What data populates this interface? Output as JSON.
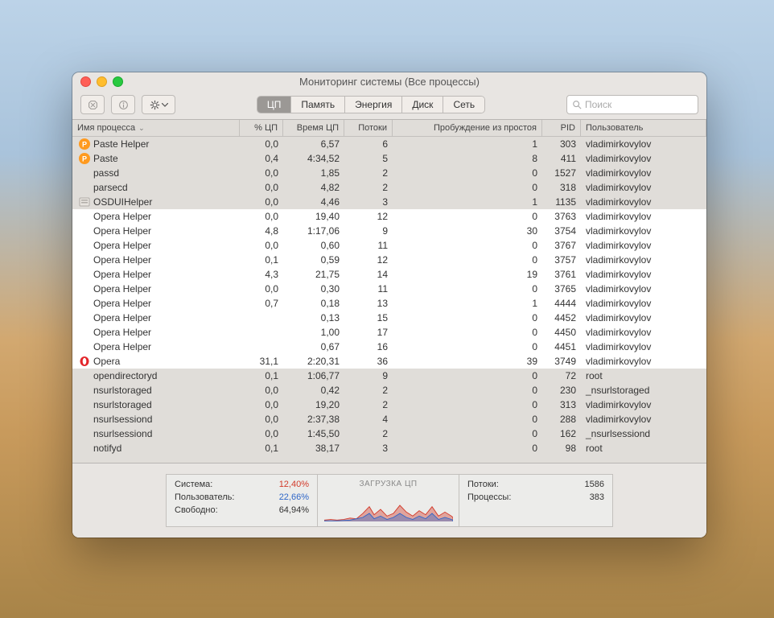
{
  "window": {
    "title": "Мониторинг системы (Все процессы)"
  },
  "toolbar": {
    "tabs": [
      "ЦП",
      "Память",
      "Энергия",
      "Диск",
      "Сеть"
    ],
    "active_tab": 0,
    "search_placeholder": "Поиск"
  },
  "columns": {
    "name": "Имя процесса",
    "cpu": "% ЦП",
    "time": "Время ЦП",
    "threads": "Потоки",
    "wake": "Пробуждение из простоя",
    "pid": "PID",
    "user": "Пользователь"
  },
  "rows": [
    {
      "icon": "paste",
      "indent": 1,
      "name": "Paste Helper",
      "cpu": "0,0",
      "time": "6,57",
      "threads": "6",
      "wake": "1",
      "pid": "303",
      "user": "vladimirkovylov",
      "sel": false
    },
    {
      "icon": "paste",
      "indent": 1,
      "name": "Paste",
      "cpu": "0,4",
      "time": "4:34,52",
      "threads": "5",
      "wake": "8",
      "pid": "411",
      "user": "vladimirkovylov",
      "sel": false
    },
    {
      "icon": "none",
      "indent": 2,
      "name": "passd",
      "cpu": "0,0",
      "time": "1,85",
      "threads": "2",
      "wake": "0",
      "pid": "1527",
      "user": "vladimirkovylov",
      "sel": false
    },
    {
      "icon": "none",
      "indent": 2,
      "name": "parsecd",
      "cpu": "0,0",
      "time": "4,82",
      "threads": "2",
      "wake": "0",
      "pid": "318",
      "user": "vladimirkovylov",
      "sel": false
    },
    {
      "icon": "generic",
      "indent": 1,
      "name": "OSDUIHelper",
      "cpu": "0,0",
      "time": "4,46",
      "threads": "3",
      "wake": "1",
      "pid": "1135",
      "user": "vladimirkovylov",
      "sel": false
    },
    {
      "icon": "none",
      "indent": 2,
      "name": "Opera Helper",
      "cpu": "0,0",
      "time": "19,40",
      "threads": "12",
      "wake": "0",
      "pid": "3763",
      "user": "vladimirkovylov",
      "sel": true
    },
    {
      "icon": "none",
      "indent": 2,
      "name": "Opera Helper",
      "cpu": "4,8",
      "time": "1:17,06",
      "threads": "9",
      "wake": "30",
      "pid": "3754",
      "user": "vladimirkovylov",
      "sel": true
    },
    {
      "icon": "none",
      "indent": 2,
      "name": "Opera Helper",
      "cpu": "0,0",
      "time": "0,60",
      "threads": "11",
      "wake": "0",
      "pid": "3767",
      "user": "vladimirkovylov",
      "sel": true
    },
    {
      "icon": "none",
      "indent": 2,
      "name": "Opera Helper",
      "cpu": "0,1",
      "time": "0,59",
      "threads": "12",
      "wake": "0",
      "pid": "3757",
      "user": "vladimirkovylov",
      "sel": true
    },
    {
      "icon": "none",
      "indent": 2,
      "name": "Opera Helper",
      "cpu": "4,3",
      "time": "21,75",
      "threads": "14",
      "wake": "19",
      "pid": "3761",
      "user": "vladimirkovylov",
      "sel": true
    },
    {
      "icon": "none",
      "indent": 2,
      "name": "Opera Helper",
      "cpu": "0,0",
      "time": "0,30",
      "threads": "11",
      "wake": "0",
      "pid": "3765",
      "user": "vladimirkovylov",
      "sel": true
    },
    {
      "icon": "none",
      "indent": 2,
      "name": "Opera Helper",
      "cpu": "0,7",
      "time": "0,18",
      "threads": "13",
      "wake": "1",
      "pid": "4444",
      "user": "vladimirkovylov",
      "sel": true
    },
    {
      "icon": "none",
      "indent": 2,
      "name": "Opera Helper",
      "cpu": "",
      "time": "0,13",
      "threads": "15",
      "wake": "0",
      "pid": "4452",
      "user": "vladimirkovylov",
      "sel": true
    },
    {
      "icon": "none",
      "indent": 2,
      "name": "Opera Helper",
      "cpu": "",
      "time": "1,00",
      "threads": "17",
      "wake": "0",
      "pid": "4450",
      "user": "vladimirkovylov",
      "sel": true
    },
    {
      "icon": "none",
      "indent": 2,
      "name": "Opera Helper",
      "cpu": "",
      "time": "0,67",
      "threads": "16",
      "wake": "0",
      "pid": "4451",
      "user": "vladimirkovylov",
      "sel": true
    },
    {
      "icon": "opera",
      "indent": 1,
      "name": "Opera",
      "cpu": "31,1",
      "time": "2:20,31",
      "threads": "36",
      "wake": "39",
      "pid": "3749",
      "user": "vladimirkovylov",
      "sel": true
    },
    {
      "icon": "none",
      "indent": 2,
      "name": "opendirectoryd",
      "cpu": "0,1",
      "time": "1:06,77",
      "threads": "9",
      "wake": "0",
      "pid": "72",
      "user": "root",
      "sel": false
    },
    {
      "icon": "none",
      "indent": 2,
      "name": "nsurlstoraged",
      "cpu": "0,0",
      "time": "0,42",
      "threads": "2",
      "wake": "0",
      "pid": "230",
      "user": "_nsurlstoraged",
      "sel": false
    },
    {
      "icon": "none",
      "indent": 2,
      "name": "nsurlstoraged",
      "cpu": "0,0",
      "time": "19,20",
      "threads": "2",
      "wake": "0",
      "pid": "313",
      "user": "vladimirkovylov",
      "sel": false
    },
    {
      "icon": "none",
      "indent": 2,
      "name": "nsurlsessiond",
      "cpu": "0,0",
      "time": "2:37,38",
      "threads": "4",
      "wake": "0",
      "pid": "288",
      "user": "vladimirkovylov",
      "sel": false
    },
    {
      "icon": "none",
      "indent": 2,
      "name": "nsurlsessiond",
      "cpu": "0,0",
      "time": "1:45,50",
      "threads": "2",
      "wake": "0",
      "pid": "162",
      "user": "_nsurlsessiond",
      "sel": false
    },
    {
      "icon": "none",
      "indent": 2,
      "name": "notifyd",
      "cpu": "0,1",
      "time": "38,17",
      "threads": "3",
      "wake": "0",
      "pid": "98",
      "user": "root",
      "sel": false
    }
  ],
  "footer": {
    "left": {
      "system_label": "Система:",
      "system_value": "12,40%",
      "user_label": "Пользователь:",
      "user_value": "22,66%",
      "idle_label": "Свободно:",
      "idle_value": "64,94%"
    },
    "mid_title": "ЗАГРУЗКА ЦП",
    "right": {
      "threads_label": "Потоки:",
      "threads_value": "1586",
      "procs_label": "Процессы:",
      "procs_value": "383"
    }
  }
}
